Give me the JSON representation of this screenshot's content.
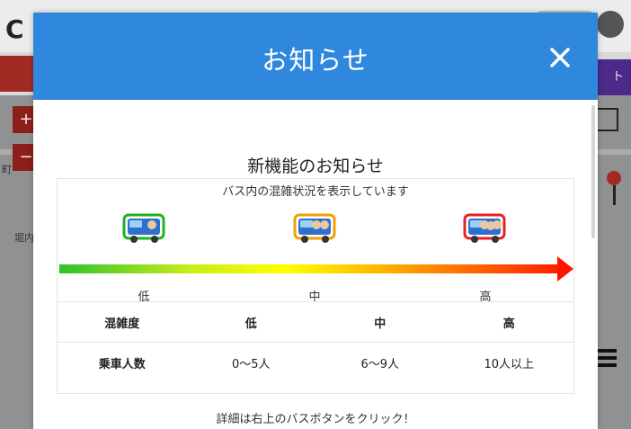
{
  "modal": {
    "title": "お知らせ",
    "heading": "新機能のお知らせ",
    "subtitle": "バス内の混雑状況を表示しています",
    "levels": {
      "low": "低",
      "mid": "中",
      "high": "高"
    },
    "table": {
      "header": [
        "混雑度",
        "低",
        "中",
        "高"
      ],
      "row": [
        "乗車人数",
        "0〜5人",
        "6〜9人",
        "10人以上"
      ]
    },
    "footer": "詳細は右上のバスボタンをクリック！"
  },
  "background": {
    "logo_letter": "C",
    "right_tab_label": "ト",
    "zoom_in": "+",
    "zoom_out": "−",
    "map_labels": [
      "町",
      "堀内"
    ]
  },
  "colors": {
    "header": "#2f87de",
    "low": "#1db41d",
    "mid": "#f0a000",
    "high": "#e82020"
  },
  "icons": {
    "close": "close-icon",
    "bus_low": "bus-low-congestion-icon",
    "bus_mid": "bus-mid-congestion-icon",
    "bus_high": "bus-high-congestion-icon"
  }
}
